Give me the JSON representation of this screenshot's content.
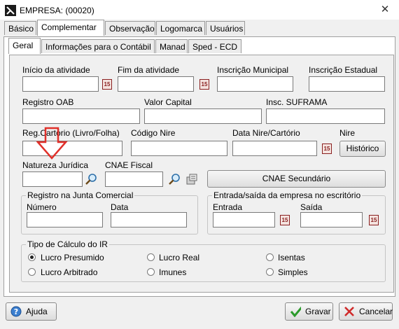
{
  "window": {
    "title": "EMPRESA: (00020)",
    "close_glyph": "✕"
  },
  "tabs_main": [
    "Básico",
    "Complementar",
    "Observação",
    "Logomarca",
    "Usuários"
  ],
  "tabs_sub": [
    "Geral",
    "Informações para o Contábil",
    "Manad",
    "Sped - ECD"
  ],
  "fields": {
    "inicio_atividade": "Início da atividade",
    "fim_atividade": "Fim da atividade",
    "inscricao_municipal": "Inscrição Municipal",
    "inscricao_estadual": "Inscrição Estadual",
    "registro_oab": "Registro OAB",
    "valor_capital": "Valor Capital",
    "insc_suframa": "Insc. SUFRAMA",
    "reg_cartorio": "Reg.Cartório (Livro/Folha)",
    "codigo_nire": "Código Nire",
    "data_nire": "Data Nire/Cartório",
    "nire": "Nire",
    "natureza_juridica": "Natureza Jurídica",
    "cnae_fiscal": "CNAE Fiscal"
  },
  "buttons": {
    "historico": "Histórico",
    "cnae_secundario": "CNAE Secundário",
    "ajuda": "Ajuda",
    "gravar": "Gravar",
    "cancelar": "Cancelar"
  },
  "junta": {
    "title": "Registro na Junta Comercial",
    "numero": "Número",
    "data": "Data"
  },
  "entrada_saida": {
    "title": "Entrada/saída da empresa no escritório",
    "entrada": "Entrada",
    "saida": "Saída"
  },
  "ir": {
    "title": "Tipo de Cálculo do IR",
    "options": [
      "Lucro Presumido",
      "Lucro Real",
      "Isentas",
      "Lucro Arbitrado",
      "Imunes",
      "Simples"
    ],
    "selected": "Lucro Presumido"
  },
  "calendar_glyph": "15",
  "annotation_color": "#e0302a"
}
